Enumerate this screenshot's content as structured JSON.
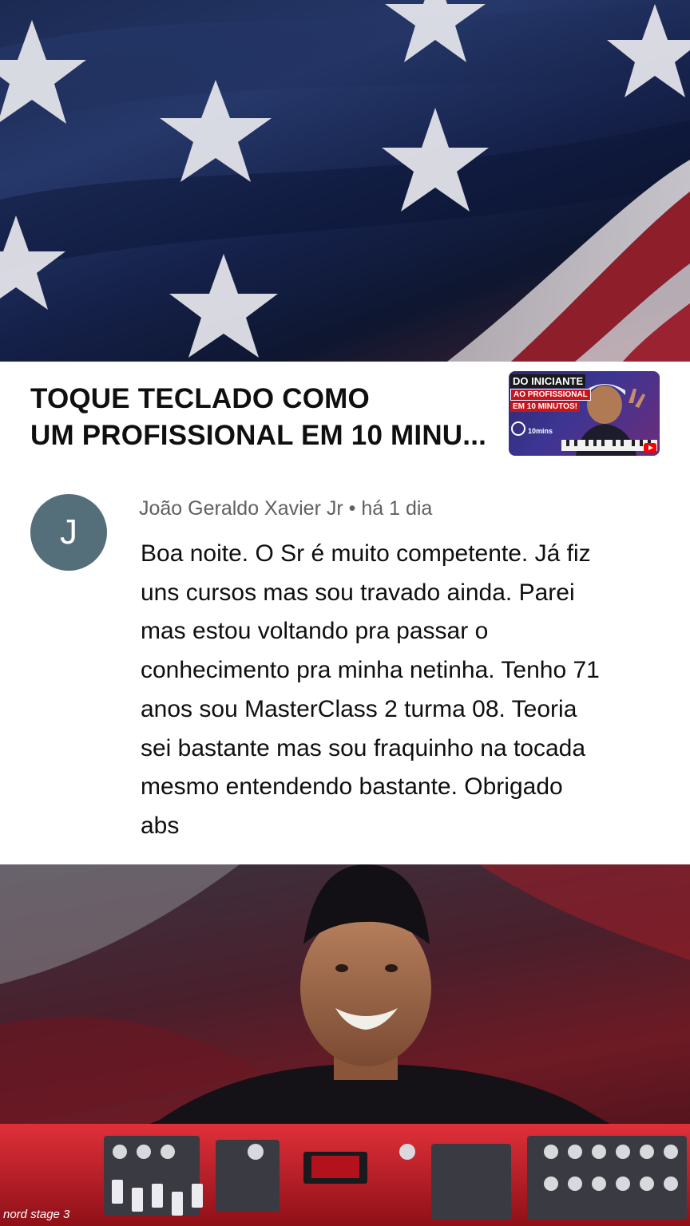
{
  "video": {
    "title_line1": "TOQUE TECLADO COMO",
    "title_line2": "UM PROFISSIONAL EM 10 MINU...",
    "thumbnail": {
      "tag1": "DO INICIANTE",
      "tag2": "AO PROFISSIONAL",
      "tag3": "EM 10 MINUTOS!",
      "timer": "10mins"
    }
  },
  "comment": {
    "avatar_letter": "J",
    "author": "João Geraldo Xavier Jr",
    "separator": " • ",
    "time": "há 1 dia",
    "lines": [
      "Boa noite. O Sr é muito competente. Já fiz",
      "uns cursos mas sou travado ainda. Parei",
      "mas estou voltando pra passar o",
      "conhecimento pra minha netinha. Tenho 71",
      "anos sou MasterClass 2 turma 08. Teoria",
      "sei bastante mas sou fraquinho na tocada",
      "mesmo entendendo bastante. Obrigado",
      "abs"
    ]
  },
  "bottom_image": {
    "brand_text": "nord stage 3"
  },
  "colors": {
    "avatar_bg": "#546e7a",
    "meta_text": "#606060",
    "body_text": "#0f0f0f",
    "flag_blue": "#1b2a52",
    "keyboard_red": "#c4161c"
  }
}
